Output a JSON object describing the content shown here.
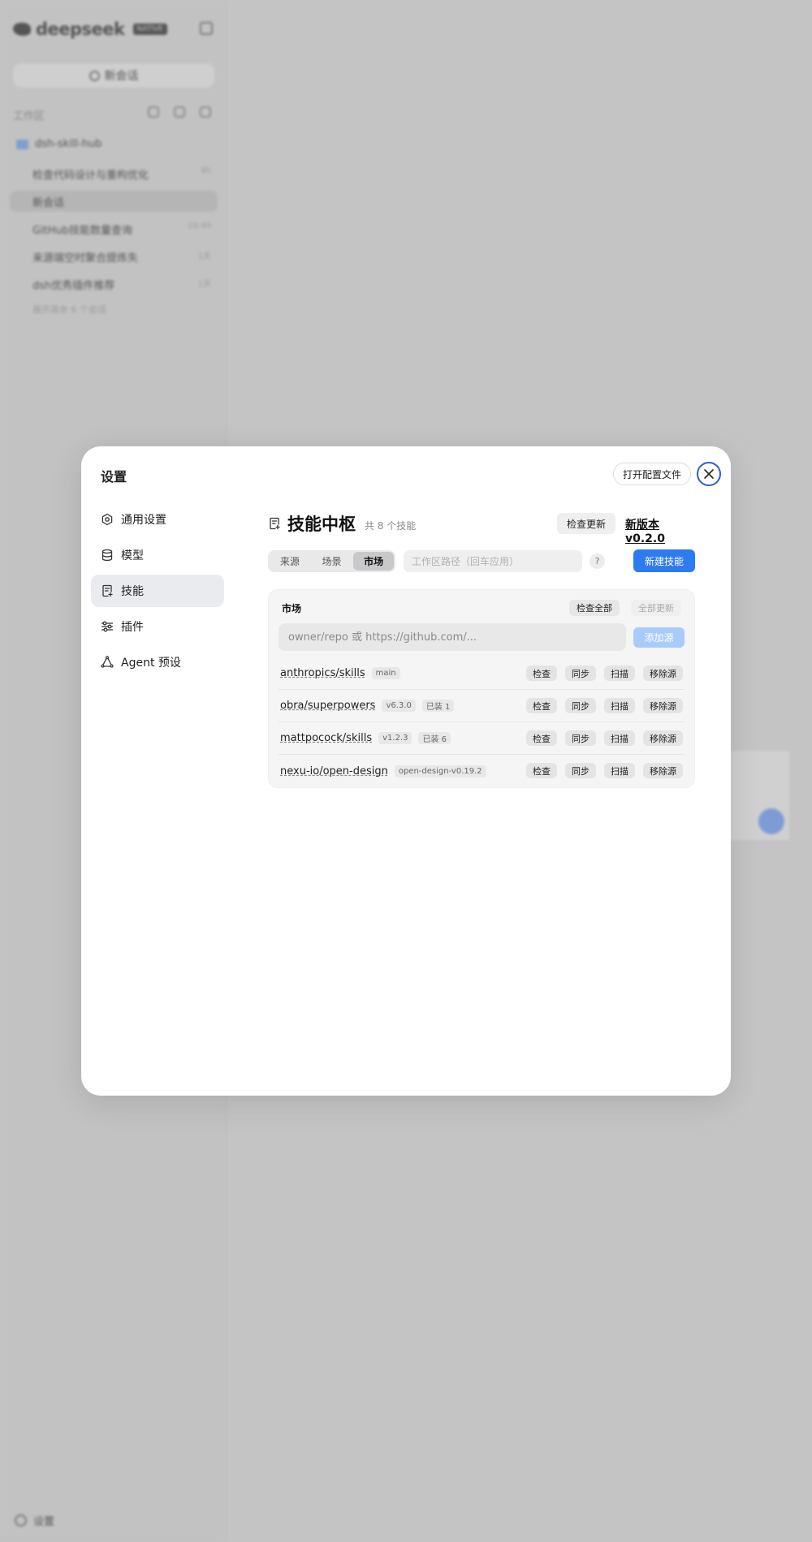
{
  "background": {
    "brand": "deepseek",
    "brand_badge": "NATIVE",
    "new_chat": "新会话",
    "workspace_label": "工作区",
    "folder": "dsh-skill-hub",
    "items": [
      {
        "label": "检查代码设计与重构优化",
        "time": "9h"
      },
      {
        "label": "新会话",
        "time": ""
      },
      {
        "label": "GitHub技能数量查询",
        "time": "10:40"
      },
      {
        "label": "来源端空时聚合提炼失",
        "time": "1天"
      },
      {
        "label": "dsh优秀插件推荐",
        "time": "1天"
      }
    ],
    "more": "展开其余 6 个会话",
    "settings": "设置"
  },
  "modal": {
    "title": "设置",
    "open_config": "打开配置文件",
    "nav": [
      {
        "label": "通用设置",
        "icon": "gear-icon"
      },
      {
        "label": "模型",
        "icon": "database-icon"
      },
      {
        "label": "技能",
        "icon": "skill-doc-icon"
      },
      {
        "label": "插件",
        "icon": "sliders-icon"
      },
      {
        "label": "Agent 预设",
        "icon": "agent-icon"
      }
    ],
    "active_nav": "技能"
  },
  "hub": {
    "title": "技能中枢",
    "count": "共 8 个技能",
    "check_update": "检查更新",
    "new_version": "新版本 v0.2.0",
    "tabs": [
      "来源",
      "场景",
      "市场"
    ],
    "active_tab": "市场",
    "path_placeholder": "工作区路径（回车应用）",
    "help": "?",
    "new_skill": "新建技能"
  },
  "market": {
    "title": "市场",
    "check_all": "检查全部",
    "update_all": "全部更新",
    "repo_placeholder": "owner/repo 或 https://github.com/...",
    "add_source": "添加源",
    "repos": [
      {
        "name": "anthropics/skills",
        "tags": [
          "main"
        ]
      },
      {
        "name": "obra/superpowers",
        "tags": [
          "v6.3.0",
          "已装 1"
        ]
      },
      {
        "name": "mattpocock/skills",
        "tags": [
          "v1.2.3",
          "已装 6"
        ]
      },
      {
        "name": "nexu-io/open-design",
        "tags": [
          "open-design-v0.19.2"
        ]
      }
    ],
    "actions": [
      "检查",
      "同步",
      "扫描",
      "移除源"
    ]
  },
  "colors": {
    "accent": "#2d7bf0",
    "accent_disabled": "#a9cbfa",
    "close_ring": "#2b60c8",
    "overlay": "#c4c4c5"
  }
}
